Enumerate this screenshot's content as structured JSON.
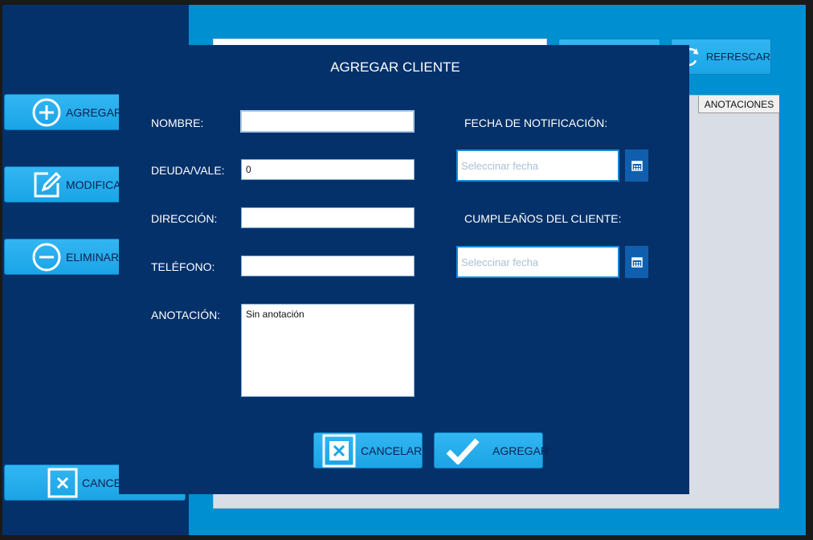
{
  "main": {
    "refresh_label": "REFRESCAR",
    "table_header_annotations": "ANOTACIONES"
  },
  "sidebar": {
    "add_label": "AGREGAR C",
    "modify_label": "MODIFICAR",
    "delete_label": "ELIMINAR",
    "cancel_label": "CANCE"
  },
  "modal": {
    "title": "AGREGAR CLIENTE",
    "labels": {
      "nombre": "NOMBRE:",
      "deuda": "DEUDA/VALE:",
      "direccion": "DIRECCIÓN:",
      "telefono": "TELÉFONO:",
      "anotacion": "ANOTACIÓN:",
      "fecha_notificacion": "FECHA DE NOTIFICACIÓN:",
      "cumpleanos": "CUMPLEAÑOS DEL CLIENTE:"
    },
    "values": {
      "nombre": "",
      "deuda": "0",
      "direccion": "",
      "telefono": "",
      "anotacion": "Sin anotación"
    },
    "date_placeholder": "Seleccinar fecha",
    "cancel_label": "CANCELAR",
    "add_label": "AGREGAR"
  },
  "icons": {
    "add": "plus-circle-icon",
    "modify": "edit-icon",
    "delete": "minus-circle-icon",
    "cancel": "close-box-icon",
    "refresh": "refresh-icon",
    "calendar": "calendar-icon",
    "confirm": "check-icon"
  },
  "colors": {
    "panel": "#04316a",
    "accent": "#1aa4e6",
    "window": "#0090d2"
  }
}
